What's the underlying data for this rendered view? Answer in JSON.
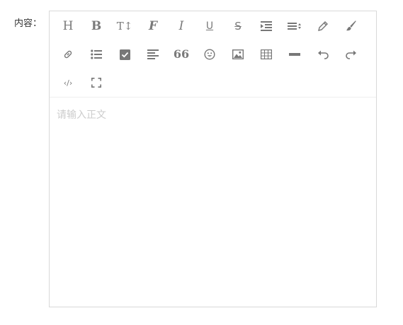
{
  "form": {
    "content_label": "内容："
  },
  "editor": {
    "placeholder": "请输入正文",
    "toolbar": {
      "rows": [
        [
          {
            "icon": "heading-icon",
            "glyph": "H"
          },
          {
            "icon": "bold-icon",
            "glyph": "B"
          },
          {
            "icon": "font-size-icon",
            "glyph": "T↕"
          },
          {
            "icon": "font-family-icon",
            "glyph": "F"
          },
          {
            "icon": "italic-icon",
            "glyph": "I"
          },
          {
            "icon": "underline-icon",
            "glyph": "U"
          },
          {
            "icon": "strikethrough-icon",
            "glyph": "S"
          },
          {
            "icon": "indent-icon"
          },
          {
            "icon": "line-height-icon"
          },
          {
            "icon": "font-color-icon"
          },
          {
            "icon": "background-color-icon"
          }
        ],
        [
          {
            "icon": "link-icon"
          },
          {
            "icon": "bulleted-list-icon"
          },
          {
            "icon": "todo-checkbox-icon"
          },
          {
            "icon": "align-left-icon"
          },
          {
            "icon": "quote-icon",
            "glyph": "66"
          },
          {
            "icon": "emoji-icon"
          },
          {
            "icon": "image-icon"
          },
          {
            "icon": "table-icon"
          },
          {
            "icon": "divider-icon"
          },
          {
            "icon": "undo-icon"
          },
          {
            "icon": "redo-icon"
          }
        ],
        [
          {
            "icon": "code-icon",
            "glyph": "‹/›"
          },
          {
            "icon": "fullscreen-icon"
          }
        ]
      ]
    }
  },
  "colors": {
    "icon": "#777777",
    "border": "#d9d9d9",
    "placeholder": "#cccccc",
    "label": "#333333"
  }
}
